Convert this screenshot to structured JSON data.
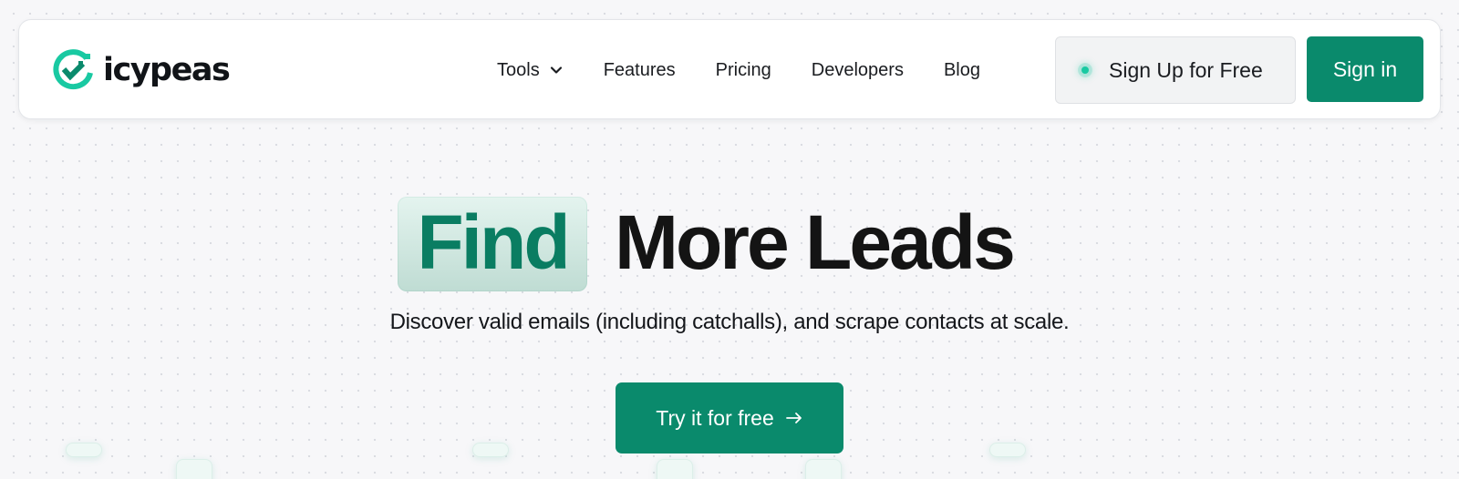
{
  "brand": {
    "name": "icypeas",
    "accent_color": "#0a8a6c",
    "logo_icon": "checkmark-circle-icon"
  },
  "nav": {
    "items": [
      {
        "label": "Tools",
        "has_dropdown": true,
        "icon": "chevron-down-icon"
      },
      {
        "label": "Features"
      },
      {
        "label": "Pricing"
      },
      {
        "label": "Developers"
      },
      {
        "label": "Blog"
      }
    ],
    "signup_label": "Sign Up for Free",
    "signup_status_color": "#19c9a2",
    "signin_label": "Sign in"
  },
  "hero": {
    "title_highlight": "Find",
    "title_rest": "More Leads",
    "subtitle": "Discover valid emails (including catchalls), and scrape contacts at scale.",
    "cta_label": "Try it for free",
    "cta_icon": "arrow-right-icon"
  }
}
